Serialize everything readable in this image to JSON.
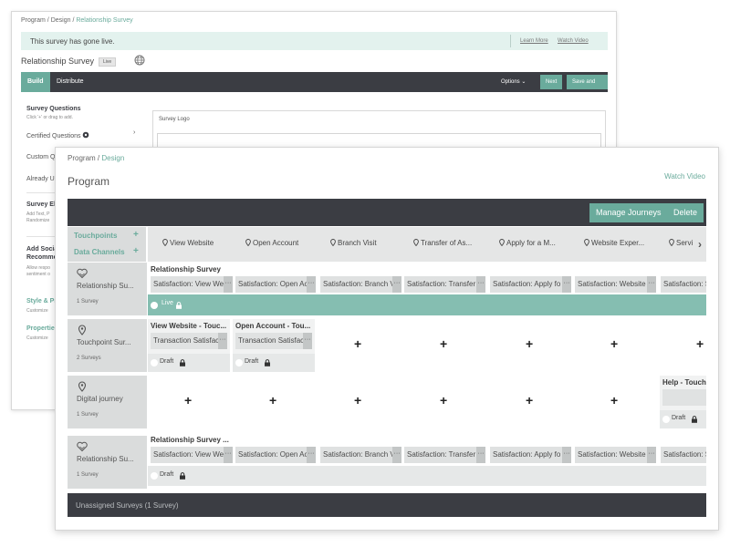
{
  "back": {
    "breadcrumb": {
      "a": "Program",
      "sep": "/",
      "b": "Design",
      "c": "Relationship Survey"
    },
    "banner": {
      "message": "This survey has gone live.",
      "learn": "Learn More",
      "watch": "Watch Video"
    },
    "survey_title": "Relationship Survey",
    "live_badge": "Live",
    "tabs": [
      "Build",
      "Distribute"
    ],
    "options": "Options",
    "next": "Next",
    "save_exit": "Save and Exit",
    "sidebar": {
      "questions_title": "Survey Questions",
      "questions_sub": "Click '+' or drag to add.",
      "certified": "Certified Questions",
      "custom": "Custom Q",
      "already": "Already U",
      "elements_title": "Survey El",
      "elements_sub1": "Add Text, P",
      "elements_sub2": "Randomize",
      "social_title1": "Add Socia",
      "social_title2": "Recomme",
      "social_sub1": "Allow respo",
      "social_sub2": "sentiment o",
      "style_title": "Style & Pr",
      "style_sub": "Customize",
      "props_title": "Propertie",
      "props_sub": "Customize"
    },
    "canvas_label": "Survey Logo"
  },
  "front": {
    "breadcrumb": {
      "a": "Program",
      "sep": "/",
      "b": "Design"
    },
    "title": "Program",
    "watch_video": "Watch Video",
    "manage": "Manage Journeys",
    "delete": "Delete",
    "touchpoints": "Touchpoints",
    "channels": "Data Channels",
    "columns": [
      "View Website",
      "Open Account",
      "Branch Visit",
      "Transfer of As...",
      "Apply for a M...",
      "Website Exper...",
      "Servi"
    ],
    "rows": [
      {
        "name": "Relationship Su...",
        "count": "1 Survey"
      },
      {
        "name": "Touchpoint Sur...",
        "count": "2 Surveys"
      },
      {
        "name": "Digital journey",
        "count": "1 Survey"
      },
      {
        "name": "Relationship Su...",
        "count": "1 Survey"
      }
    ],
    "r1": {
      "title": "Relationship Survey",
      "chips": [
        "Satisfaction: View We",
        "Satisfaction: Open Ac",
        "Satisfaction: Branch V",
        "Satisfaction: Transfer",
        "Satisfaction: Apply fo",
        "Satisfaction: Website",
        "Satisfaction: S"
      ],
      "status": "Live"
    },
    "r2": {
      "t1": "View Website - Touc...",
      "c1": "Transaction Satisfac",
      "s1": "Draft",
      "t2": "Open Account - Tou...",
      "c2": "Transaction Satisfac",
      "s2": "Draft"
    },
    "r3": {
      "t7": "Help - Touchp",
      "s7": "Draft"
    },
    "r4": {
      "title": "Relationship Survey ...",
      "chips": [
        "Satisfaction: View We",
        "Satisfaction: Open Ac",
        "Satisfaction: Branch V",
        "Satisfaction: Transfer",
        "Satisfaction: Apply fo",
        "Satisfaction: Website",
        "Satisfaction: S"
      ],
      "status": "Draft"
    },
    "plus": "+",
    "dots": "···",
    "unassigned": "Unassigned Surveys (1 Survey)"
  }
}
